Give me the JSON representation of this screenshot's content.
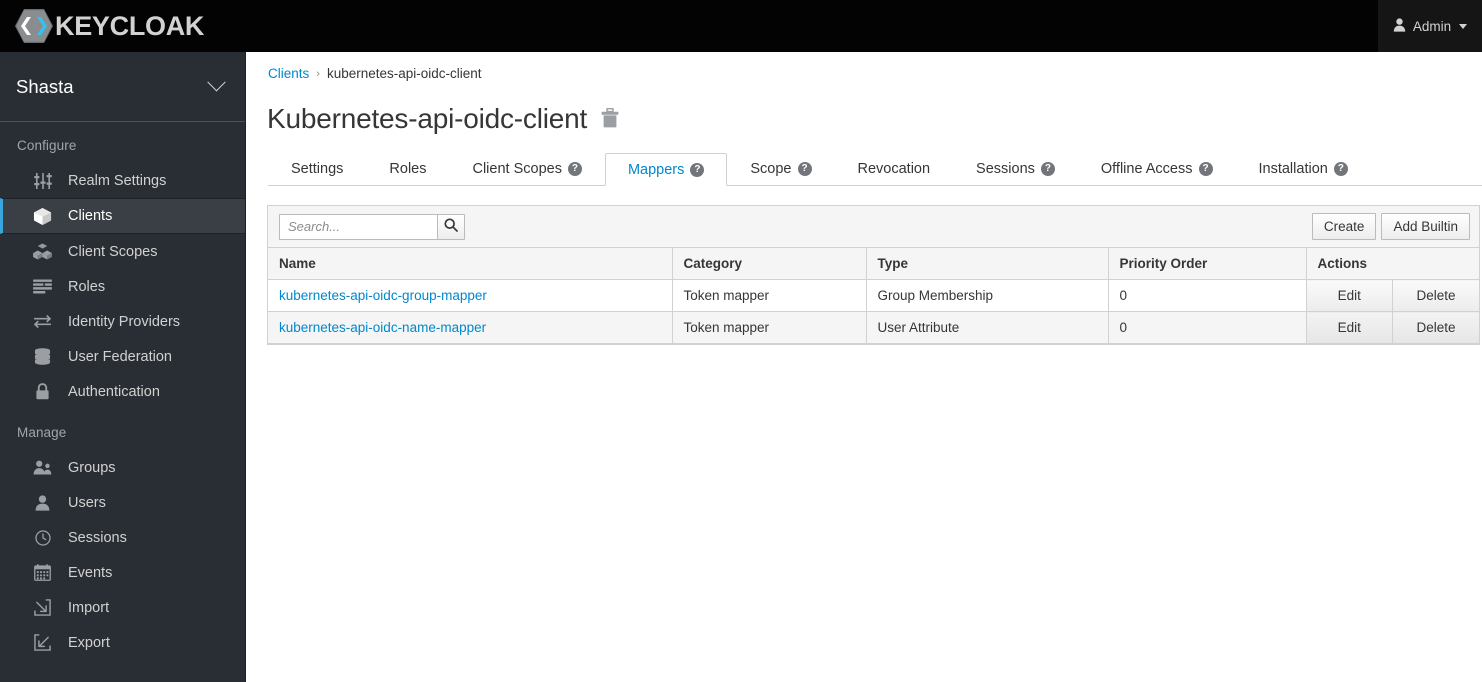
{
  "masthead": {
    "brand_text": "KEYCLOAK",
    "logo_icon": "keycloak-hex-logo",
    "user_label": "Admin",
    "user_icon": "user-icon",
    "caret_icon": "chevron-down-icon"
  },
  "sidebar": {
    "realm": {
      "name": "Shasta",
      "chevron_icon": "chevron-down-icon"
    },
    "sections": [
      {
        "title": "Configure",
        "items": [
          {
            "label": "Realm Settings",
            "icon": "sliders-icon",
            "active": false
          },
          {
            "label": "Clients",
            "icon": "cube-icon",
            "active": true
          },
          {
            "label": "Client Scopes",
            "icon": "cubes-icon",
            "active": false
          },
          {
            "label": "Roles",
            "icon": "list-bars-icon",
            "active": false
          },
          {
            "label": "Identity Providers",
            "icon": "exchange-arrows-icon",
            "active": false
          },
          {
            "label": "User Federation",
            "icon": "database-icon",
            "active": false
          },
          {
            "label": "Authentication",
            "icon": "lock-icon",
            "active": false
          }
        ]
      },
      {
        "title": "Manage",
        "items": [
          {
            "label": "Groups",
            "icon": "users-group-icon",
            "active": false
          },
          {
            "label": "Users",
            "icon": "user-icon",
            "active": false
          },
          {
            "label": "Sessions",
            "icon": "clock-icon",
            "active": false
          },
          {
            "label": "Events",
            "icon": "calendar-icon",
            "active": false
          },
          {
            "label": "Import",
            "icon": "import-arrow-icon",
            "active": false
          },
          {
            "label": "Export",
            "icon": "export-arrow-icon",
            "active": false
          }
        ]
      }
    ]
  },
  "breadcrumb": {
    "parent": "Clients",
    "separator": "›",
    "current": "kubernetes-api-oidc-client"
  },
  "page": {
    "title": "Kubernetes-api-oidc-client",
    "delete_icon": "trash-icon"
  },
  "tabs": [
    {
      "label": "Settings",
      "help": false,
      "active": false
    },
    {
      "label": "Roles",
      "help": false,
      "active": false
    },
    {
      "label": "Client Scopes",
      "help": true,
      "active": false
    },
    {
      "label": "Mappers",
      "help": true,
      "active": true
    },
    {
      "label": "Scope",
      "help": true,
      "active": false
    },
    {
      "label": "Revocation",
      "help": false,
      "active": false
    },
    {
      "label": "Sessions",
      "help": true,
      "active": false
    },
    {
      "label": "Offline Access",
      "help": true,
      "active": false
    },
    {
      "label": "Installation",
      "help": true,
      "active": false
    }
  ],
  "toolbar": {
    "search_value": "",
    "search_placeholder": "Search...",
    "search_icon": "search-icon",
    "create_label": "Create",
    "add_builtin_label": "Add Builtin"
  },
  "table": {
    "columns": [
      "Name",
      "Category",
      "Type",
      "Priority Order",
      "Actions"
    ],
    "rows": [
      {
        "name": "kubernetes-api-oidc-group-mapper",
        "category": "Token mapper",
        "type": "Group Membership",
        "priority": "0",
        "edit": "Edit",
        "delete": "Delete"
      },
      {
        "name": "kubernetes-api-oidc-name-mapper",
        "category": "Token mapper",
        "type": "User Attribute",
        "priority": "0",
        "edit": "Edit",
        "delete": "Delete"
      }
    ]
  },
  "colors": {
    "masthead_bg": "#030303",
    "sidebar_bg": "#292e34",
    "sidebar_active_bg": "#393f44",
    "accent_blue": "#0088ce",
    "active_marker": "#39a5dc",
    "text_dark": "#363636",
    "panel_border": "#d1d1d1",
    "toolbar_bg": "#f5f5f5"
  }
}
